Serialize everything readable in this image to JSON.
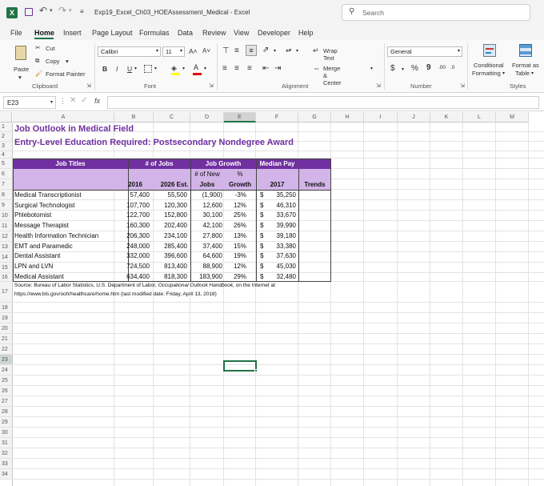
{
  "titlebar": {
    "filename": "Exp19_Excel_Ch03_HOEAssessment_Medical",
    "separator": " - ",
    "app": "Excel",
    "search_placeholder": "Search",
    "qat_more": "≡"
  },
  "menu": [
    "File",
    "Home",
    "Insert",
    "Page Layout",
    "Formulas",
    "Data",
    "Review",
    "View",
    "Developer",
    "Help"
  ],
  "menu_active": "Home",
  "ribbon": {
    "clipboard": {
      "paste": "Paste",
      "cut": "Cut",
      "copy": "Copy",
      "format_painter": "Format Painter",
      "label": "Clipboard"
    },
    "font": {
      "name": "Calibri",
      "size": "11",
      "bold": "B",
      "italic": "I",
      "underline": "U",
      "grow": "A˄",
      "shrink": "A˅",
      "font_color": "A",
      "label": "Font"
    },
    "alignment": {
      "wrap": "Wrap Text",
      "merge": "Merge & Center",
      "label": "Alignment"
    },
    "number": {
      "format": "General",
      "currency": "$",
      "percent": "%",
      "comma": "9",
      "inc": ".00",
      "dec": ".0",
      "label": "Number"
    },
    "styles": {
      "conditional1": "Conditional",
      "conditional2": "Formatting",
      "format_as1": "Format as",
      "format_as2": "Table",
      "label": "Styles"
    }
  },
  "formula_bar": {
    "name_box": "E23",
    "fx": "fx",
    "value": ""
  },
  "columns": [
    "A",
    "B",
    "C",
    "D",
    "E",
    "F",
    "G",
    "H",
    "I",
    "J",
    "K",
    "L",
    "M"
  ],
  "rows": [
    "1",
    "2",
    "3",
    "4",
    "5",
    "6",
    "7",
    "8",
    "9",
    "10",
    "11",
    "12",
    "13",
    "14",
    "15",
    "16",
    "17",
    "18",
    "19",
    "20",
    "21",
    "22",
    "23",
    "24",
    "25",
    "26",
    "27",
    "28",
    "29",
    "30",
    "31",
    "32",
    "33",
    "34"
  ],
  "sheet": {
    "title": "Job Outlook in Medical Field",
    "subtitle": "Entry-Level Education Required: Postsecondary Nondegree Award",
    "header": {
      "job_titles": "Job Titles",
      "num_jobs": "# of Jobs",
      "job_growth": "Job Growth",
      "median_pay": "Median Pay",
      "num_new": "# of New",
      "pct": "%",
      "y2016": "2016",
      "y2026": "2026 Est.",
      "jobs": "Jobs",
      "growth": "Growth",
      "y2017": "2017",
      "trends": "Trends"
    },
    "data": [
      {
        "title": "Medical Transcriptionist",
        "y2016": "57,400",
        "y2026": "55,500",
        "new": "(1,900)",
        "pct": "-3%",
        "cur": "$",
        "pay": "35,250"
      },
      {
        "title": "Surgical Technologist",
        "y2016": "107,700",
        "y2026": "120,300",
        "new": "12,600",
        "pct": "12%",
        "cur": "$",
        "pay": "46,310"
      },
      {
        "title": "Phlebotomist",
        "y2016": "122,700",
        "y2026": "152,800",
        "new": "30,100",
        "pct": "25%",
        "cur": "$",
        "pay": "33,670"
      },
      {
        "title": "Message Therapist",
        "y2016": "160,300",
        "y2026": "202,400",
        "new": "42,100",
        "pct": "26%",
        "cur": "$",
        "pay": "39,990"
      },
      {
        "title": "Health Information Technician",
        "y2016": "206,300",
        "y2026": "234,100",
        "new": "27,800",
        "pct": "13%",
        "cur": "$",
        "pay": "39,180"
      },
      {
        "title": "EMT and Paramedic",
        "y2016": "248,000",
        "y2026": "285,400",
        "new": "37,400",
        "pct": "15%",
        "cur": "$",
        "pay": "33,380"
      },
      {
        "title": "Dental Assistant",
        "y2016": "332,000",
        "y2026": "396,600",
        "new": "64,600",
        "pct": "19%",
        "cur": "$",
        "pay": "37,630"
      },
      {
        "title": "LPN and LVN",
        "y2016": "724,500",
        "y2026": "813,400",
        "new": "88,900",
        "pct": "12%",
        "cur": "$",
        "pay": "45,030"
      },
      {
        "title": "Medical Assistant",
        "y2016": "634,400",
        "y2026": "818,300",
        "new": "183,900",
        "pct": "29%",
        "cur": "$",
        "pay": "32,480"
      }
    ],
    "source_line1_a": "Source: Bureau of Labor Statistics, U.S. Department of Labor, ",
    "source_line1_b": "Occupational Outlook Handbook,",
    "source_line1_c": " on the Internet at",
    "source_line2": "https://www.bls.gov/ooh/healthcare/home.htm (last modified date: Friday, April 13, 2018)"
  },
  "colors": {
    "header_dark": "#7030a0",
    "header_light": "#d2b4e8",
    "title": "#7030a0",
    "selection": "#217346"
  }
}
